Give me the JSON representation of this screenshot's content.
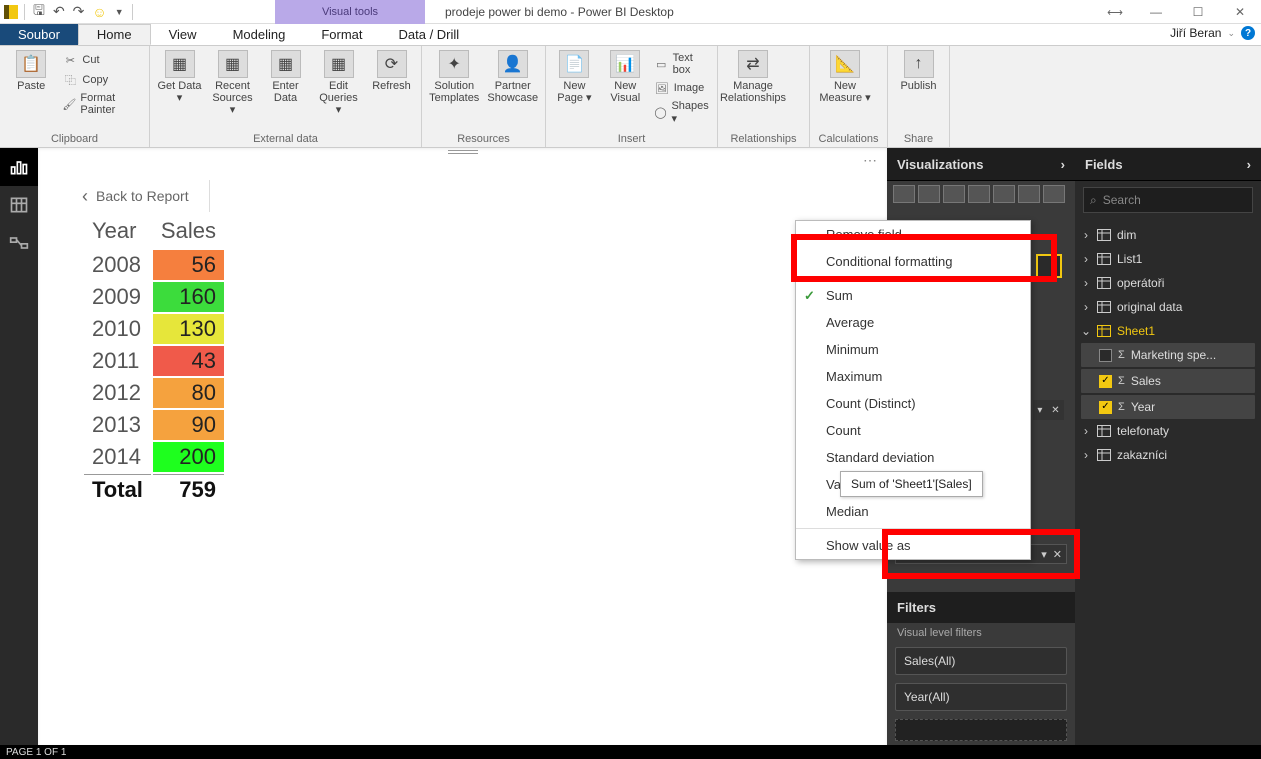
{
  "titlebar": {
    "visual_tools": "Visual tools",
    "title": "prodeje power bi demo - Power BI Desktop"
  },
  "user": {
    "name": "Jiří Beran"
  },
  "tabs": {
    "file": "Soubor",
    "home": "Home",
    "view": "View",
    "modeling": "Modeling",
    "format": "Format",
    "datadrill": "Data / Drill"
  },
  "ribbon": {
    "clipboard": {
      "group": "Clipboard",
      "paste": "Paste",
      "cut": "Cut",
      "copy": "Copy",
      "fmt": "Format Painter"
    },
    "external": {
      "group": "External data",
      "getdata": "Get Data ▾",
      "recent": "Recent Sources ▾",
      "enter": "Enter Data",
      "edit": "Edit Queries ▾",
      "refresh": "Refresh"
    },
    "resources": {
      "group": "Resources",
      "solution": "Solution Templates",
      "partner": "Partner Showcase"
    },
    "insert": {
      "group": "Insert",
      "newpage": "New Page ▾",
      "newvisual": "New Visual",
      "textbox": "Text box",
      "image": "Image",
      "shapes": "Shapes ▾"
    },
    "rel": {
      "group": "Relationships",
      "manage": "Manage Relationships"
    },
    "calc": {
      "group": "Calculations",
      "measure": "New Measure ▾"
    },
    "share": {
      "group": "Share",
      "publish": "Publish"
    }
  },
  "back_to_report": "Back to Report",
  "data": {
    "headers": {
      "year": "Year",
      "sales": "Sales"
    },
    "rows": [
      {
        "year": "2008",
        "sales": "56",
        "bg": "#f57f3e"
      },
      {
        "year": "2009",
        "sales": "160",
        "bg": "#3cdc3c"
      },
      {
        "year": "2010",
        "sales": "130",
        "bg": "#e6e63a"
      },
      {
        "year": "2011",
        "sales": "43",
        "bg": "#f05a4a"
      },
      {
        "year": "2012",
        "sales": "80",
        "bg": "#f5a23e"
      },
      {
        "year": "2013",
        "sales": "90",
        "bg": "#f5a23e"
      },
      {
        "year": "2014",
        "sales": "200",
        "bg": "#1eff1e"
      }
    ],
    "total_label": "Total",
    "total_value": "759"
  },
  "context": {
    "remove": "Remove field",
    "cond": "Conditional formatting",
    "sum": "Sum",
    "avg": "Average",
    "min": "Minimum",
    "max": "Maximum",
    "countd": "Count (Distinct)",
    "count": "Count",
    "std": "Standard deviation",
    "var": "Variance",
    "med": "Median",
    "showval": "Show value as"
  },
  "tooltip": "Sum of 'Sheet1'[Sales]",
  "viz_header": "Visualizations",
  "filters": {
    "header": "Filters",
    "vlf": "Visual level filters",
    "sales": "Sales(All)",
    "year": "Year(All)"
  },
  "fields": {
    "header": "Fields",
    "search_placeholder": "Search",
    "tables": {
      "dim": "dim",
      "list1": "List1",
      "oper": "operátoři",
      "orig": "original data",
      "sheet1": "Sheet1",
      "tel": "telefonaty",
      "zak": "zakazníci"
    },
    "sheet1_fields": {
      "mkt": "Marketing spe...",
      "sales": "Sales",
      "year": "Year"
    }
  },
  "status": "PAGE 1 OF 1"
}
